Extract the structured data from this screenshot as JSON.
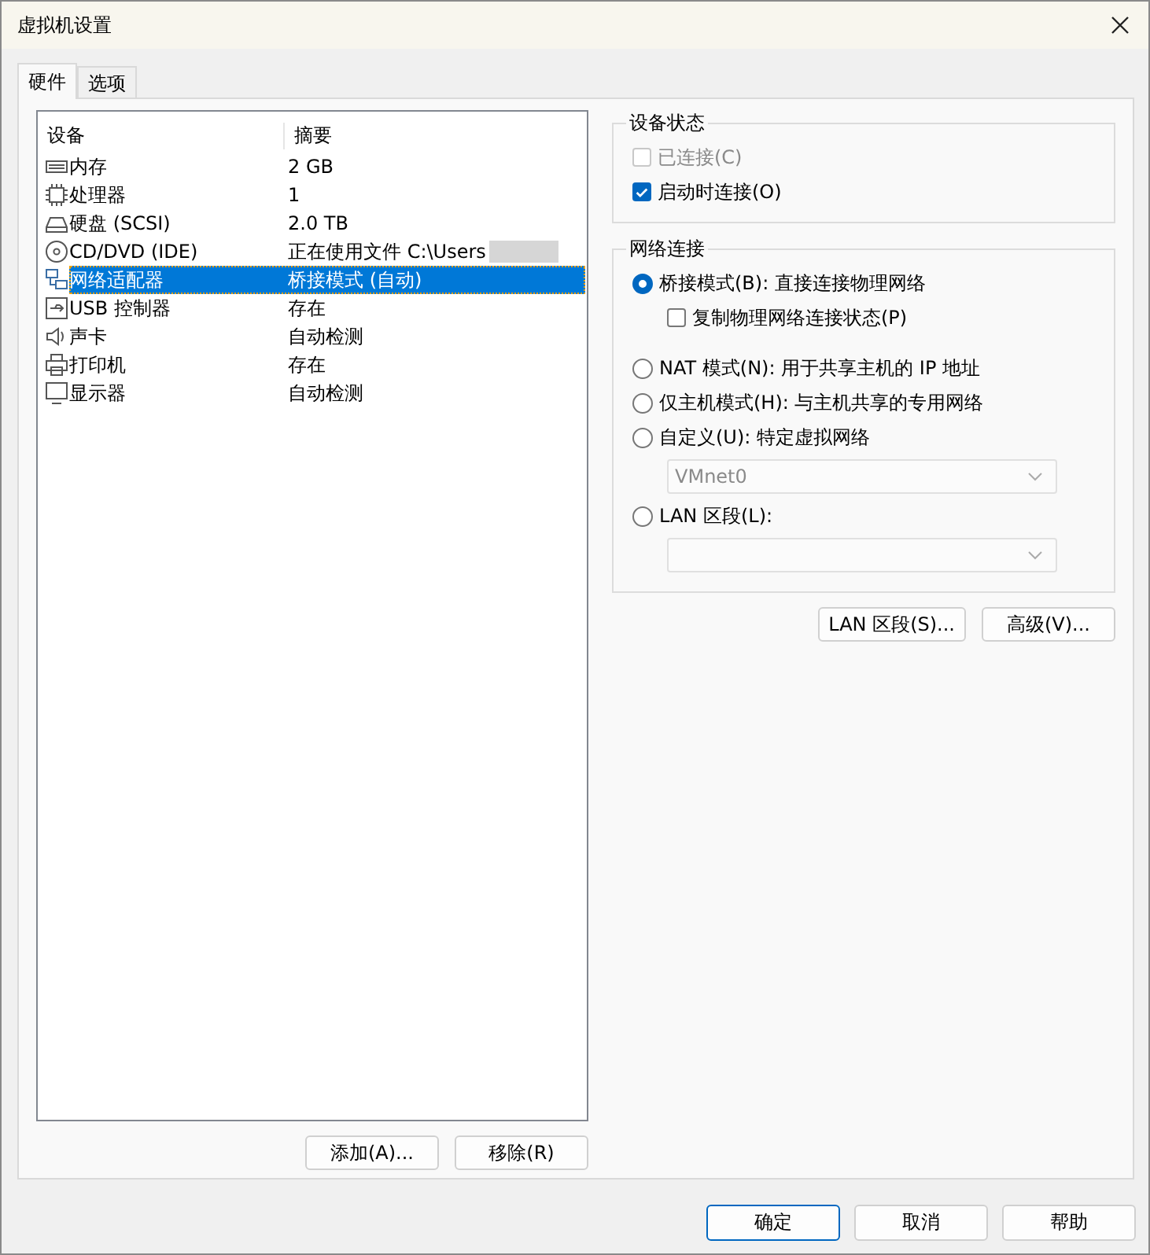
{
  "window": {
    "title": "虚拟机设置"
  },
  "tabs": [
    {
      "label": "硬件",
      "selected": true
    },
    {
      "label": "选项",
      "selected": false
    }
  ],
  "device_list": {
    "columns": [
      "设备",
      "摘要"
    ],
    "rows": [
      {
        "kind": "memory",
        "device": "内存",
        "summary": "2 GB",
        "selected": false
      },
      {
        "kind": "cpu",
        "device": "处理器",
        "summary": "1",
        "selected": false
      },
      {
        "kind": "disk",
        "device": "硬盘 (SCSI)",
        "summary": "2.0 TB",
        "selected": false
      },
      {
        "kind": "cdrom",
        "device": "CD/DVD (IDE)",
        "summary": "正在使用文件 C:\\Users",
        "redacted": true,
        "selected": false
      },
      {
        "kind": "network",
        "device": "网络适配器",
        "summary": "桥接模式 (自动)",
        "selected": true
      },
      {
        "kind": "usb",
        "device": "USB 控制器",
        "summary": "存在",
        "selected": false
      },
      {
        "kind": "sound",
        "device": "声卡",
        "summary": "自动检测",
        "selected": false
      },
      {
        "kind": "printer",
        "device": "打印机",
        "summary": "存在",
        "selected": false
      },
      {
        "kind": "display",
        "device": "显示器",
        "summary": "自动检测",
        "selected": false
      }
    ]
  },
  "list_buttons": [
    "添加(A)...",
    "移除(R)"
  ],
  "device_status": {
    "title": "设备状态",
    "options": [
      {
        "label": "已连接(C)",
        "checked": false,
        "disabled": true
      },
      {
        "label": "启动时连接(O)",
        "checked": true,
        "disabled": false
      }
    ]
  },
  "network_connection": {
    "title": "网络连接",
    "items": [
      {
        "kind": "radio",
        "label": "桥接模式(B): 直接连接物理网络",
        "selected": true
      },
      {
        "kind": "checkbox",
        "label": "复制物理网络连接状态(P)",
        "checked": false
      },
      {
        "kind": "radio",
        "label": "NAT 模式(N): 用于共享主机的 IP 地址",
        "selected": false
      },
      {
        "kind": "radio",
        "label": "仅主机模式(H): 与主机共享的专用网络",
        "selected": false
      },
      {
        "kind": "radio",
        "label": "自定义(U): 特定虚拟网络",
        "selected": false
      },
      {
        "kind": "dropdown",
        "value": "VMnet0",
        "disabled": true
      },
      {
        "kind": "radio",
        "label": "LAN 区段(L):",
        "selected": false
      },
      {
        "kind": "dropdown",
        "disabled": true
      }
    ]
  },
  "network_buttons": [
    "LAN 区段(S)...",
    "高级(V)..."
  ],
  "dialog_buttons": [
    {
      "label": "确定",
      "default": true
    },
    {
      "label": "取消",
      "default": false
    },
    {
      "label": "帮助",
      "default": false
    }
  ]
}
